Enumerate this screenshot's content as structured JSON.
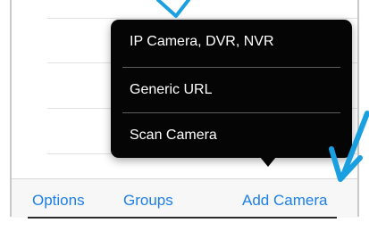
{
  "menu": {
    "items": [
      {
        "label": "IP Camera, DVR, NVR"
      },
      {
        "label": "Generic URL"
      },
      {
        "label": "Scan Camera"
      }
    ]
  },
  "toolbar": {
    "options_label": "Options",
    "groups_label": "Groups",
    "add_camera_label": "Add Camera"
  },
  "colors": {
    "accent": "#1d7fe8",
    "menu_background": "#050505",
    "annotation": "#1a9fe0"
  },
  "annotations": [
    "arrow-down-marker",
    "arrow-pointer-marker"
  ]
}
